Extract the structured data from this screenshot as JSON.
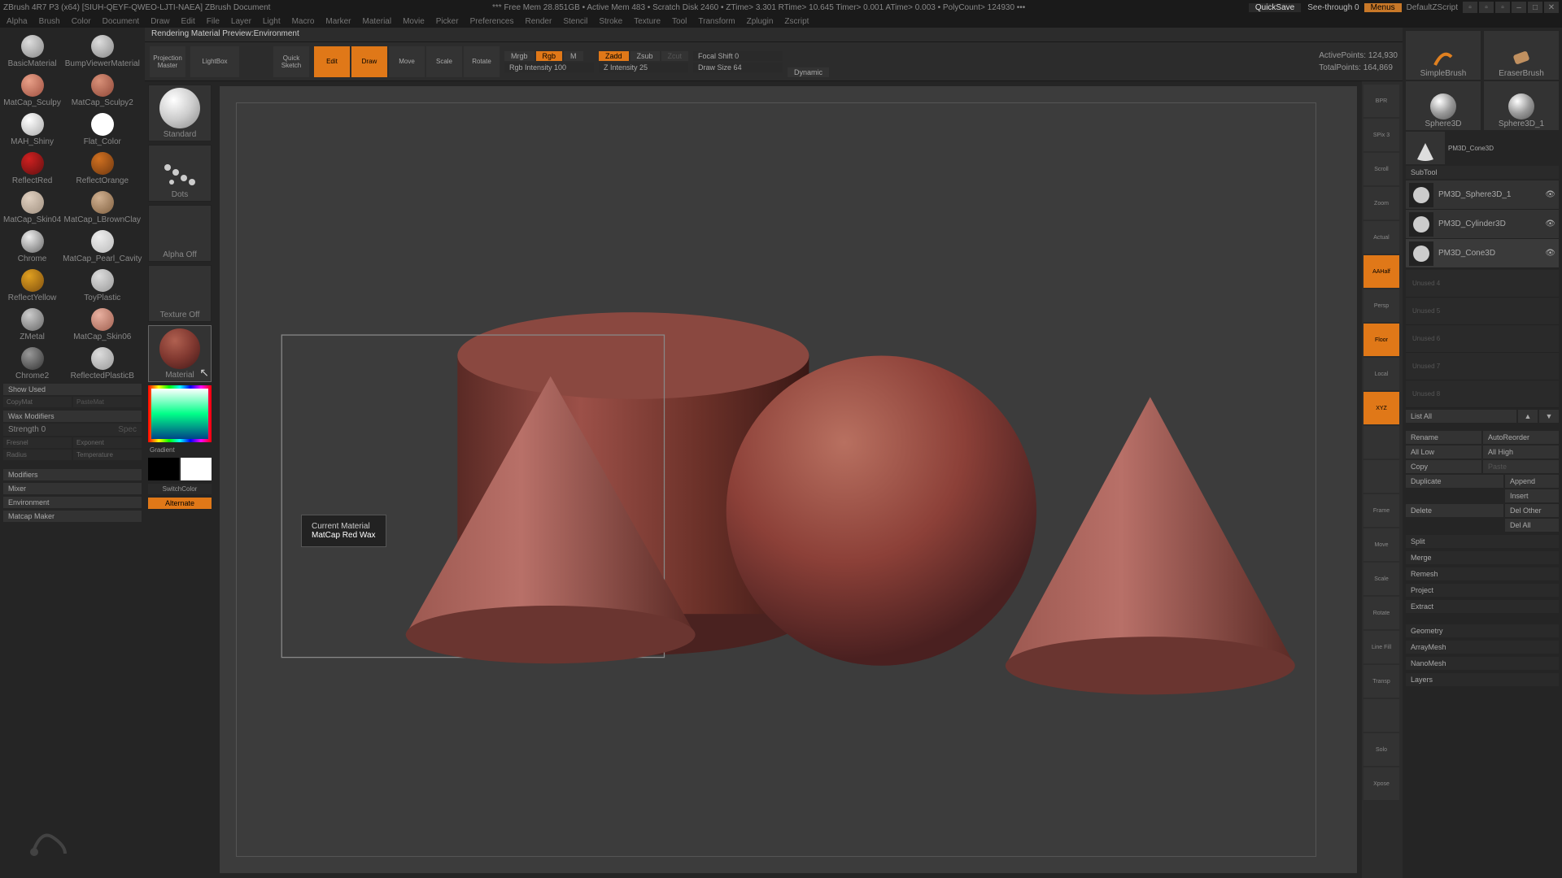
{
  "title": {
    "app": "ZBrush 4R7 P3  (x64) [SIUH-QEYF-QWEO-LJTI-NAEA]   ZBrush Document",
    "stats": "*** Free Mem 28.851GB  • Active Mem 483  • Scratch Disk 2460  • ZTime> 3.301  RTime> 10.645  Timer> 0.001  ATime> 0.003  • PolyCount> 124930  •••",
    "quicksave": "QuickSave",
    "seethru": "See-through  0",
    "menus": "Menus",
    "script": "DefaultZScript"
  },
  "menu": [
    "Alpha",
    "Brush",
    "Color",
    "Document",
    "Draw",
    "Edit",
    "File",
    "Layer",
    "Light",
    "Macro",
    "Marker",
    "Material",
    "Movie",
    "Picker",
    "Preferences",
    "Render",
    "Stencil",
    "Stroke",
    "Texture",
    "Tool",
    "Transform",
    "Zplugin",
    "Zscript"
  ],
  "info": "Rendering Material Preview:Environment",
  "shelf": {
    "projection": "Projection\nMaster",
    "lightbox": "LightBox",
    "quicksketch": "Quick\nSketch",
    "edit": "Edit",
    "draw": "Draw",
    "move": "Move",
    "scale": "Scale",
    "rotate": "Rotate",
    "mrgb": "Mrgb",
    "rgb": "Rgb",
    "m": "M",
    "rgbint": "Rgb Intensity 100",
    "zadd": "Zadd",
    "zsub": "Zsub",
    "zcut": "Zcut",
    "zint": "Z Intensity 25",
    "focal": "Focal Shift 0",
    "drawsize": "Draw Size 64",
    "dynamic": "Dynamic",
    "active": "ActivePoints:  124,930",
    "total": "TotalPoints:  164,869"
  },
  "materials": [
    {
      "n": "BasicMaterial",
      "c1": "#ddd",
      "c2": "#888"
    },
    {
      "n": "BumpViewerMaterial",
      "c1": "#ddd",
      "c2": "#888"
    },
    {
      "n": "MatCap_Sculpy",
      "c1": "#e8a088",
      "c2": "#a05040"
    },
    {
      "n": "MatCap_Sculpy2",
      "c1": "#d89078",
      "c2": "#904838"
    },
    {
      "n": "MAH_Shiny",
      "c1": "#fff",
      "c2": "#aaa"
    },
    {
      "n": "Flat_Color",
      "c1": "#fff",
      "c2": "#fff"
    },
    {
      "n": "ReflectRed",
      "c1": "#d02020",
      "c2": "#601010"
    },
    {
      "n": "ReflectOrange",
      "c1": "#d07020",
      "c2": "#703810"
    },
    {
      "n": "MatCap_Skin04",
      "c1": "#e0d0c0",
      "c2": "#a09080"
    },
    {
      "n": "MatCap_LBrownClay",
      "c1": "#d0b090",
      "c2": "#806040"
    },
    {
      "n": "Chrome",
      "c1": "#eee",
      "c2": "#666"
    },
    {
      "n": "MatCap_Pearl_Cavity",
      "c1": "#eee",
      "c2": "#bbb"
    },
    {
      "n": "ReflectYellow",
      "c1": "#e0a020",
      "c2": "#805010"
    },
    {
      "n": "ToyPlastic",
      "c1": "#ddd",
      "c2": "#999"
    },
    {
      "n": "ZMetal",
      "c1": "#ccc",
      "c2": "#666"
    },
    {
      "n": "MatCap_Skin06",
      "c1": "#e8b0a0",
      "c2": "#a06050"
    },
    {
      "n": "Chrome2",
      "c1": "#999",
      "c2": "#333"
    },
    {
      "n": "ReflectedPlasticB",
      "c1": "#ddd",
      "c2": "#999"
    }
  ],
  "matpanel": {
    "showused": "Show Used",
    "copymat": "CopyMat",
    "pastemat": "PasteMat",
    "waxmod": "Wax Modifiers",
    "strength": "Strength 0",
    "spec": "Spec",
    "fresnel": "Fresnel",
    "exponent": "Exponent",
    "radius": "Radius",
    "temperature": "Temperature",
    "modifiers": "Modifiers",
    "mixer": "Mixer",
    "environment": "Environment",
    "matcapmaker": "Matcap Maker"
  },
  "leftdock": {
    "standard": "Standard",
    "dots": "Dots",
    "alphaoff": "Alpha Off",
    "textureoff": "Texture Off",
    "material": "Material",
    "gradient": "Gradient",
    "switchcolor": "SwitchColor",
    "alternate": "Alternate"
  },
  "tooltip": {
    "l1": "Current Material",
    "l2": "MatCap Red Wax"
  },
  "rdock": [
    "BPR",
    "SPix 3",
    "Scroll",
    "Zoom",
    "Actual",
    "AAHalf",
    "Persp",
    "Floor",
    "Local",
    "XYZ",
    "",
    "",
    "Frame",
    "Move",
    "Scale",
    "Rotate",
    "Line Fill",
    "Transp",
    "",
    "Solo",
    "Xpose"
  ],
  "rdock_on": [
    5,
    7,
    9
  ],
  "tools": {
    "simple": "SimpleBrush",
    "eraser": "EraserBrush",
    "s1": "Sphere3D",
    "s2": "Sphere3D_1",
    "cone": "PM3D_Cone3D"
  },
  "subtool": {
    "hdr": "SubTool",
    "items": [
      {
        "n": "PM3D_Sphere3D_1",
        "sel": false
      },
      {
        "n": "PM3D_Cylinder3D",
        "sel": false
      },
      {
        "n": "PM3D_Cone3D",
        "sel": true
      }
    ],
    "empty": [
      "Unused 4",
      "Unused 5",
      "Unused 6",
      "Unused 7",
      "Unused 8"
    ],
    "listall": "List All",
    "rename": "Rename",
    "autoreorder": "AutoReorder",
    "alllow": "All Low",
    "allhigh": "All High",
    "copy": "Copy",
    "paste": "Paste",
    "duplicate": "Duplicate",
    "append": "Append",
    "insert": "Insert",
    "delete": "Delete",
    "delother": "Del Other",
    "delall": "Del All",
    "split": "Split",
    "merge": "Merge",
    "remesh": "Remesh",
    "project": "Project",
    "extract": "Extract",
    "geometry": "Geometry",
    "arraymesh": "ArrayMesh",
    "nanomesh": "NanoMesh",
    "layers": "Layers"
  }
}
